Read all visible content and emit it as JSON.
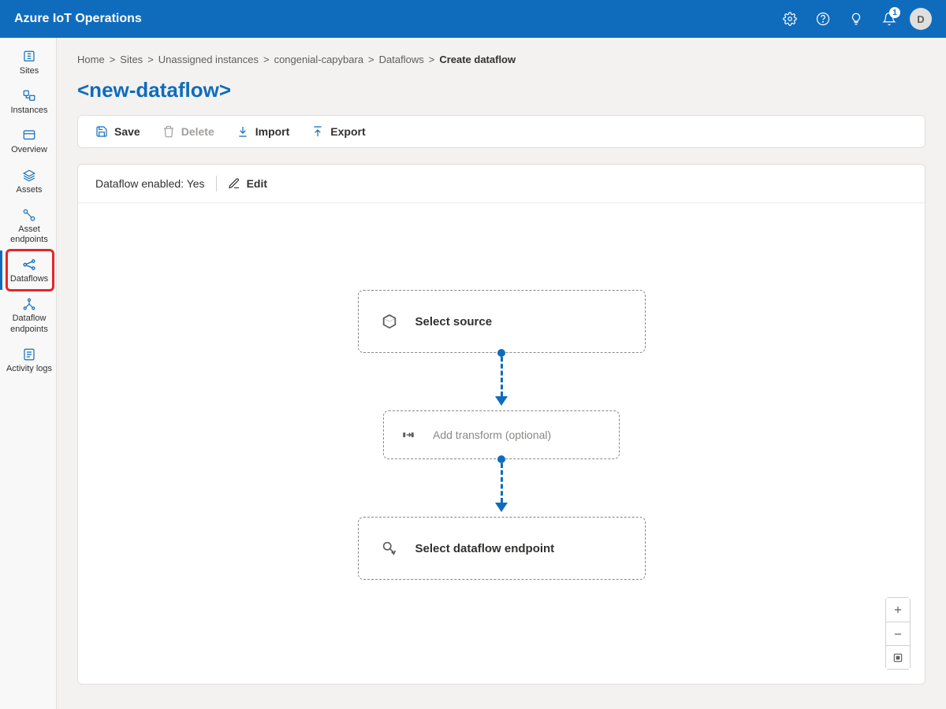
{
  "header": {
    "title": "Azure IoT Operations",
    "notification_count": "1",
    "avatar_initial": "D"
  },
  "sidebar": {
    "items": [
      {
        "label": "Sites"
      },
      {
        "label": "Instances"
      },
      {
        "label": "Overview"
      },
      {
        "label": "Assets"
      },
      {
        "label": "Asset endpoints"
      },
      {
        "label": "Dataflows"
      },
      {
        "label": "Dataflow endpoints"
      },
      {
        "label": "Activity logs"
      }
    ]
  },
  "breadcrumb": {
    "items": [
      "Home",
      "Sites",
      "Unassigned instances",
      "congenial-capybara",
      "Dataflows"
    ],
    "current": "Create dataflow"
  },
  "page": {
    "title": "<new-dataflow>"
  },
  "toolbar": {
    "save": "Save",
    "delete": "Delete",
    "import": "Import",
    "export": "Export"
  },
  "status": {
    "enabled_label": "Dataflow enabled: Yes",
    "edit": "Edit"
  },
  "canvas": {
    "source": "Select source",
    "transform": "Add transform (optional)",
    "endpoint": "Select dataflow endpoint"
  }
}
